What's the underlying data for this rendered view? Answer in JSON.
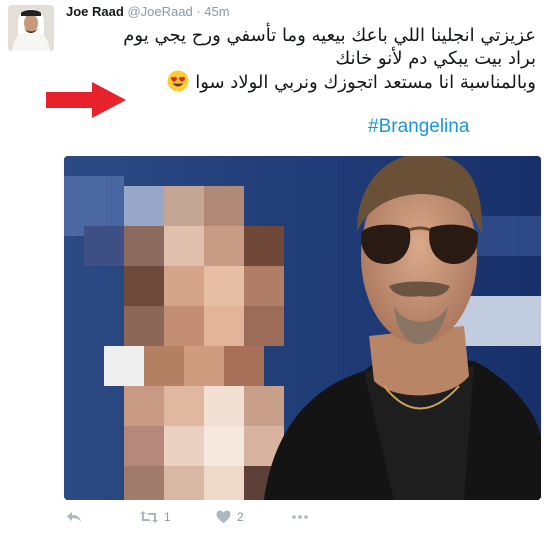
{
  "tweet": {
    "author_name": "Joe Raad",
    "handle": "@JoeRaad",
    "separator": "·",
    "time": "45m",
    "text_lines": [
      "عزيزتي انجلينا اللي باعك بيعيه وما تأسفي ورح يجي يوم",
      "براد بيت يبكي دم لأنو خانك",
      "وبالمناسبة انا مستعد اتجوزك ونربي الولاد سوا"
    ],
    "hashtag": "#Brangelina",
    "emoji": "heart-eyes-emoji"
  },
  "actions": {
    "reply_icon": "reply-icon",
    "retweet_icon": "retweet-icon",
    "retweet_count": "1",
    "like_icon": "heart-icon",
    "like_count": "2",
    "more_icon": "more-icon"
  },
  "colors": {
    "text": "#14171a",
    "muted": "#8899a6",
    "link": "#1b95e0",
    "arrow": "#e8222a"
  }
}
